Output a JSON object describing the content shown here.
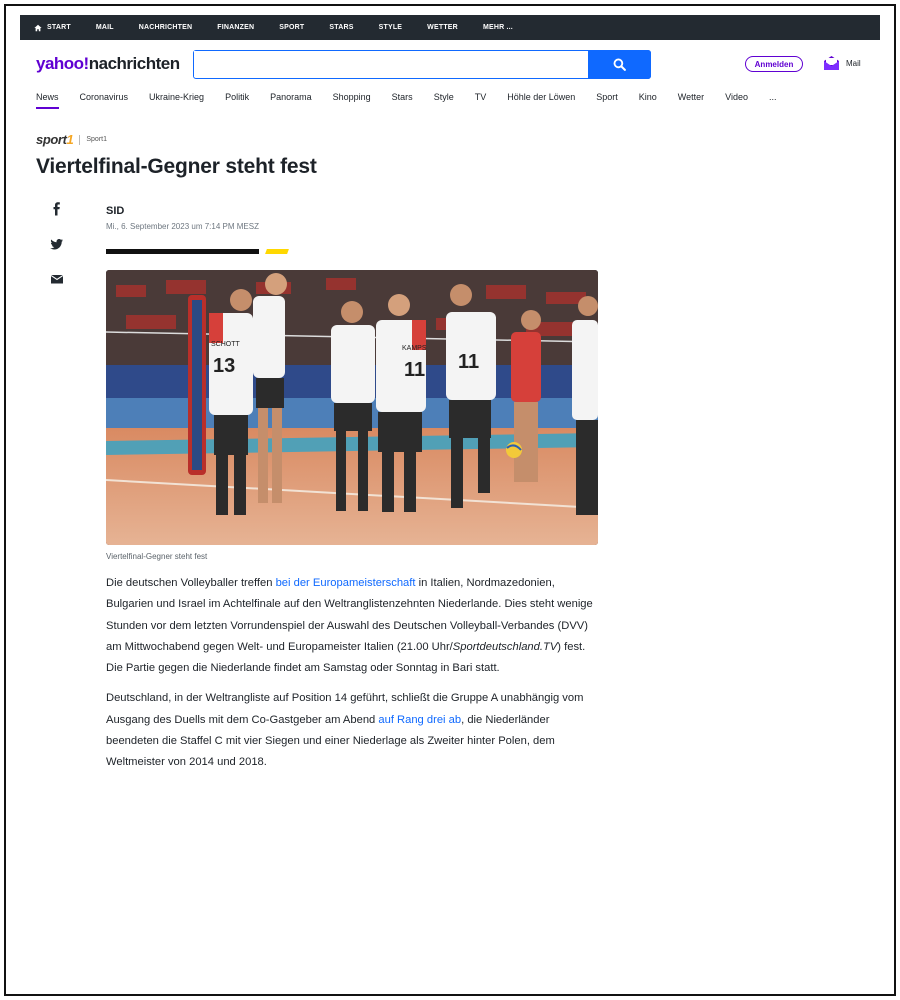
{
  "topbar": {
    "items": [
      {
        "label": "START",
        "icon": "home-icon"
      },
      {
        "label": "MAIL"
      },
      {
        "label": "NACHRICHTEN"
      },
      {
        "label": "FINANZEN"
      },
      {
        "label": "SPORT"
      },
      {
        "label": "STARS"
      },
      {
        "label": "STYLE"
      },
      {
        "label": "WETTER"
      },
      {
        "label": "MEHR ..."
      }
    ]
  },
  "header": {
    "logo_brand": "yahoo!",
    "logo_section": "nachrichten",
    "search_placeholder": "",
    "search_icon": "search-icon",
    "signin_label": "Anmelden",
    "mail_label": "Mail"
  },
  "nav": {
    "items": [
      "News",
      "Coronavirus",
      "Ukraine-Krieg",
      "Politik",
      "Panorama",
      "Shopping",
      "Stars",
      "Style",
      "TV",
      "Höhle der Löwen",
      "Sport",
      "Kino",
      "Wetter",
      "Video",
      "..."
    ],
    "active": "News"
  },
  "article": {
    "source_logo_main": "sport",
    "source_logo_num": "1",
    "source_name": "Sport1",
    "headline": "Viertelfinal-Gegner steht fest",
    "share_icons": [
      "facebook-icon",
      "twitter-icon",
      "email-icon"
    ],
    "author": "SID",
    "date": "Mi., 6. September 2023 um 7:14 PM MESZ",
    "image_caption": "Viertelfinal-Gegner steht fest",
    "jersey_names": [
      "SCHOTT",
      "KAMPS"
    ],
    "jersey_numbers": [
      "13",
      "11",
      "11"
    ],
    "p1": {
      "t1": "Die deutschen Volleyballer treffen ",
      "link1": "bei der Europameisterschaft",
      "t2": " in Italien, Nordmazedonien, Bulgarien und Israel im Achtelfinale auf den Weltranglistenzehnten Niederlande. Dies steht wenige Stunden vor dem letzten Vorrundenspiel der Auswahl des Deutschen Volleyball-Verbandes (DVV) am Mittwochabend gegen Welt- und Europameister Italien (21.00 Uhr/",
      "italic": "Sportdeutschland.TV",
      "t3": ") fest. Die Partie gegen die Niederlande findet am Samstag oder Sonntag in Bari statt."
    },
    "p2": {
      "t1": "Deutschland, in der Weltrangliste auf Position 14 geführt, schließt die Gruppe A unabhängig vom Ausgang des Duells mit dem Co-Gastgeber am Abend ",
      "link1": "auf Rang drei ab",
      "t2": ", die Niederländer beendeten die Staffel C mit vier Siegen und einer Niederlage als Zweiter hinter Polen, dem Weltmeister von 2014 und 2018."
    }
  },
  "colors": {
    "brand_purple": "#6001d2",
    "search_blue": "#0f69ff",
    "topbar_bg": "#232a31",
    "accent_yellow": "#ffd800"
  }
}
